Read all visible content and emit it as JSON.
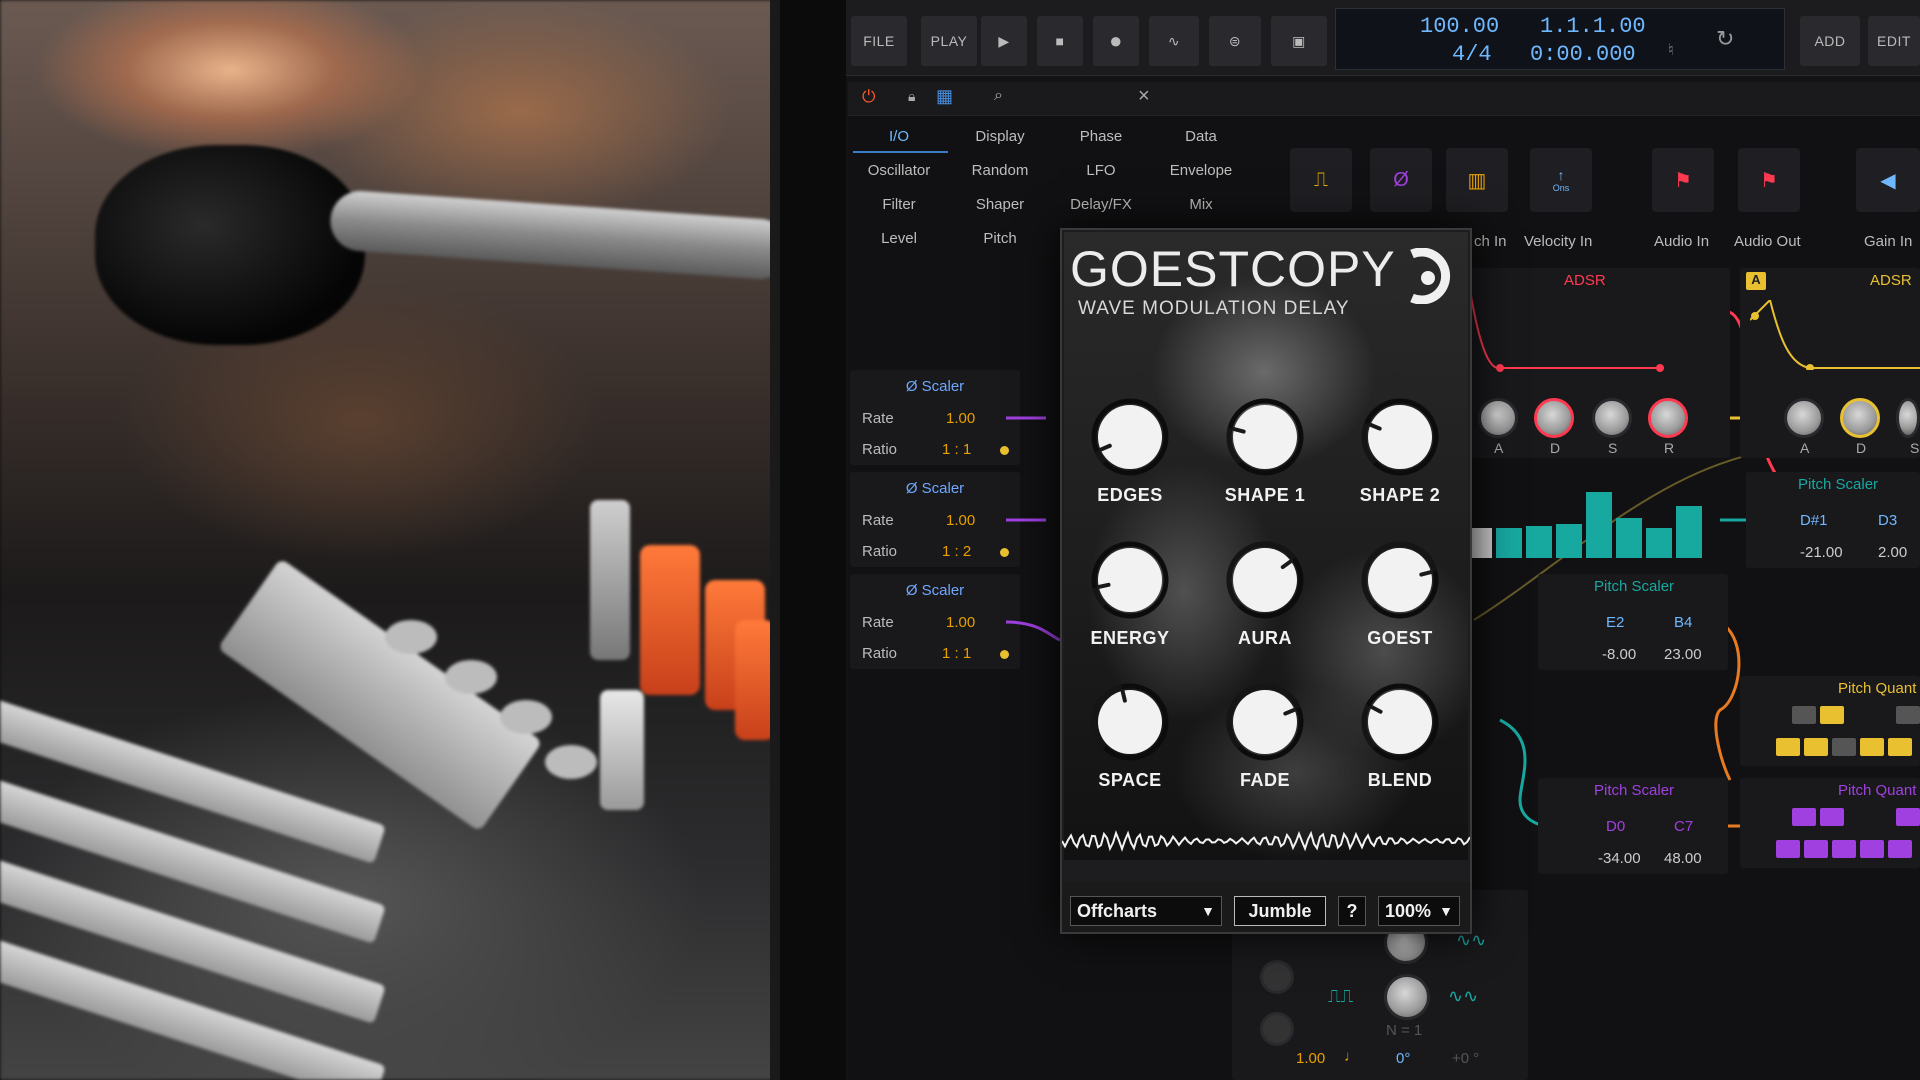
{
  "toolbar": {
    "file": "FILE",
    "play": "PLAY",
    "tempo": "100.00",
    "time_signature": "4/4",
    "position_bars": "1.1.1.00",
    "position_time": "0:00.000",
    "add": "ADD",
    "edit": "EDIT"
  },
  "device_panel": {
    "categories": [
      {
        "label": "I/O",
        "active": true
      },
      {
        "label": "Display"
      },
      {
        "label": "Phase"
      },
      {
        "label": "Data"
      },
      {
        "label": "Oscillator"
      },
      {
        "label": "Random"
      },
      {
        "label": "LFO"
      },
      {
        "label": "Envelope"
      },
      {
        "label": "Filter"
      },
      {
        "label": "Shaper"
      },
      {
        "label": "Delay/FX"
      },
      {
        "label": "Mix"
      },
      {
        "label": "Level"
      },
      {
        "label": "Pitch"
      }
    ],
    "close_glyph": "×"
  },
  "modules_row": {
    "labels": [
      "ch In",
      "Velocity In",
      "Audio In",
      "Audio Out",
      "Gain In"
    ],
    "velocity_sub": "Ons"
  },
  "scalers": [
    {
      "title": "Ø Scaler",
      "rate_label": "Rate",
      "rate": "1.00",
      "ratio_label": "Ratio",
      "ratio": "1 : 1"
    },
    {
      "title": "Ø Scaler",
      "rate_label": "Rate",
      "rate": "1.00",
      "ratio_label": "Ratio",
      "ratio": "1 : 2"
    },
    {
      "title": "Ø Scaler",
      "rate_label": "Rate",
      "rate": "1.00",
      "ratio_label": "Ratio",
      "ratio": "1 : 1"
    }
  ],
  "adsr": {
    "title": "ADSR",
    "labels": [
      "A",
      "D",
      "S",
      "R"
    ],
    "title2": "ADSR",
    "badge": "A",
    "labels2": [
      "A",
      "D",
      "S"
    ]
  },
  "pitch_scalers": [
    {
      "title": "Pitch Scaler",
      "low": "D#1",
      "high": "D3",
      "low_val": "-21.00",
      "high_val": "2.00"
    },
    {
      "title": "Pitch Scaler",
      "low": "E2",
      "high": "B4",
      "low_val": "-8.00",
      "high_val": "23.00"
    },
    {
      "title": "Pitch Scaler",
      "low": "D0",
      "high": "C7",
      "low_val": "-34.00",
      "high_val": "48.00"
    }
  ],
  "pitch_quant": [
    "Pitch Quant",
    "Pitch Quant"
  ],
  "bottom_node": {
    "n_label": "N = 1",
    "rate": "1.00",
    "note_glyph": "♩",
    "phase": "0°",
    "offset": "+0 °"
  },
  "plugin": {
    "title": "GOESTCOPY",
    "subtitle": "WAVE MODULATION DELAY",
    "knobs": [
      {
        "label": "EDGES",
        "value": 0.08
      },
      {
        "label": "SHAPE 1",
        "value": 0.22
      },
      {
        "label": "SHAPE 2",
        "value": 0.25
      },
      {
        "label": "ENERGY",
        "value": 0.12
      },
      {
        "label": "AURA",
        "value": 0.7
      },
      {
        "label": "GOEST",
        "value": 0.78
      },
      {
        "label": "SPACE",
        "value": 0.45
      },
      {
        "label": "FADE",
        "value": 0.75
      },
      {
        "label": "BLEND",
        "value": 0.27
      }
    ],
    "preset": "Offcharts",
    "jumble": "Jumble",
    "help": "?",
    "zoom": "100%"
  },
  "colors": {
    "accent_blue": "#6fb8ff",
    "orange_value": "#e8a000",
    "adsr_red": "#ff3a50",
    "teal": "#17a8a0",
    "yellow": "#e8c030",
    "purple": "#a040e0"
  }
}
